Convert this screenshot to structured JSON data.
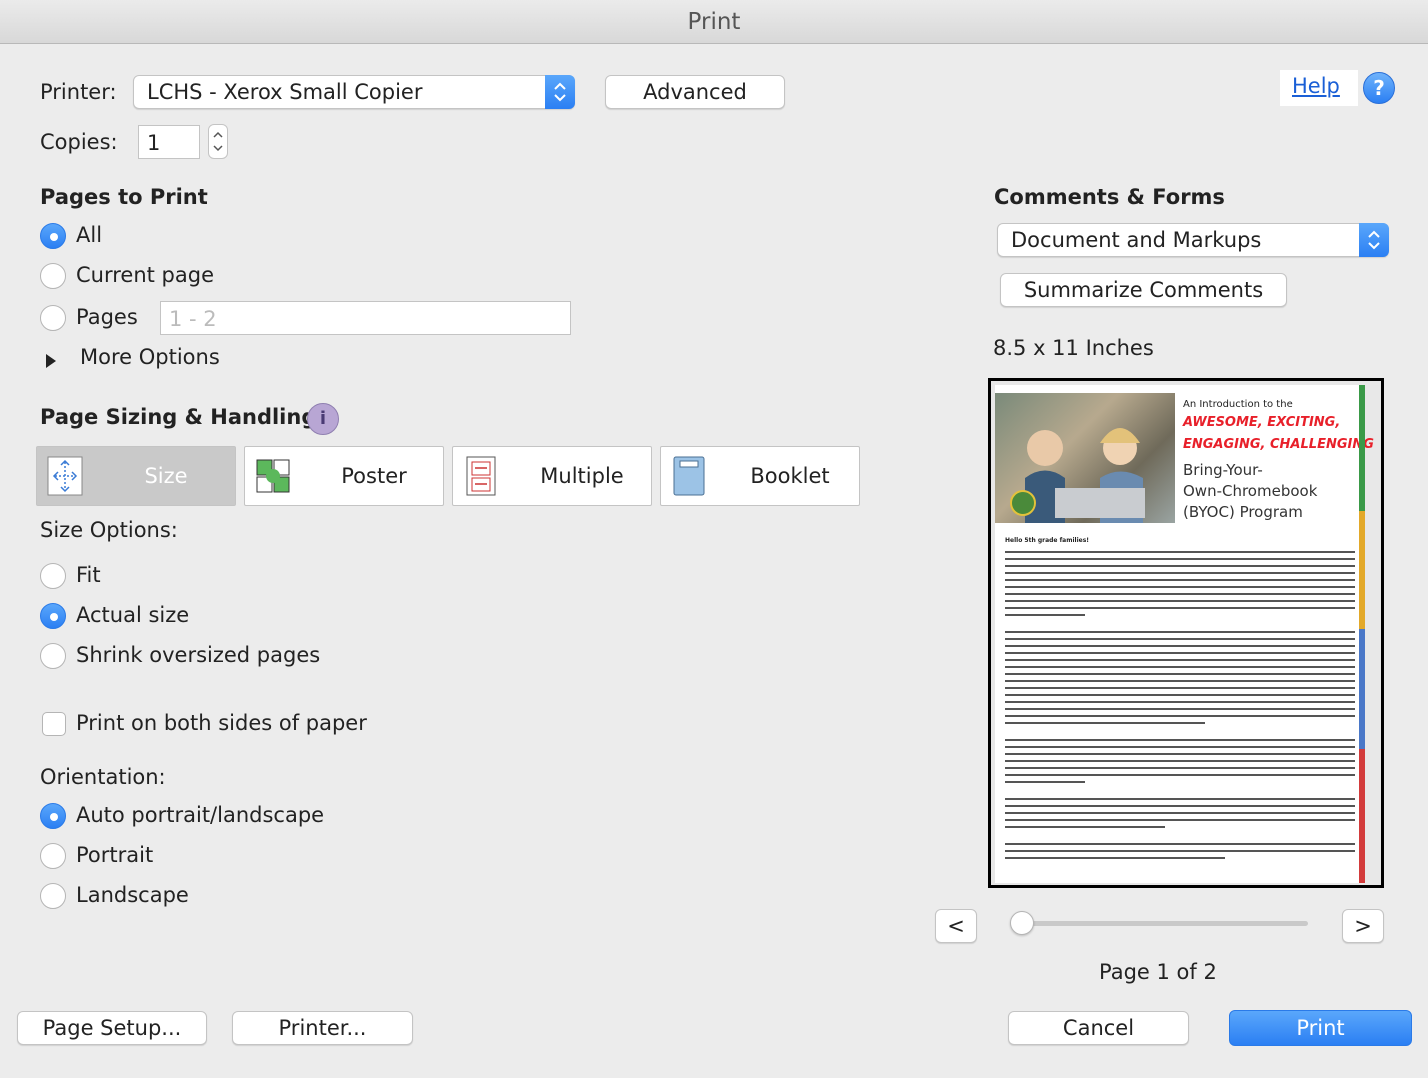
{
  "window": {
    "title": "Print"
  },
  "printer": {
    "label": "Printer:",
    "value": "LCHS - Xerox Small Copier",
    "advanced_label": "Advanced"
  },
  "copies": {
    "label": "Copies:",
    "value": "1"
  },
  "help": {
    "label": "Help"
  },
  "pages_to_print": {
    "heading": "Pages to Print",
    "options": {
      "all": "All",
      "current": "Current page",
      "pages": "Pages"
    },
    "range_placeholder": "1 - 2",
    "more_options": "More Options"
  },
  "sizing": {
    "heading": "Page Sizing & Handling",
    "modes": {
      "size": "Size",
      "poster": "Poster",
      "multiple": "Multiple",
      "booklet": "Booklet"
    },
    "size_options_label": "Size Options:",
    "size_options": {
      "fit": "Fit",
      "actual": "Actual size",
      "shrink": "Shrink oversized pages"
    },
    "duplex": "Print on both sides of paper"
  },
  "orientation": {
    "label": "Orientation:",
    "options": {
      "auto": "Auto portrait/landscape",
      "portrait": "Portrait",
      "landscape": "Landscape"
    }
  },
  "comments_forms": {
    "heading": "Comments & Forms",
    "value": "Document and Markups",
    "summarize_label": "Summarize Comments"
  },
  "preview": {
    "paper_size": "8.5 x 11 Inches",
    "prev": "<",
    "next": ">",
    "page_indicator": "Page 1 of 2",
    "doc": {
      "intro": "An Introduction to the",
      "line1": "AWESOME, EXCITING,",
      "line2": "ENGAGING, CHALLENGING",
      "line3": "Bring-Your-",
      "line4": "Own-Chromebook",
      "line5": "(BYOC) Program",
      "greeting": "Hello 5th grade families!"
    }
  },
  "buttons": {
    "page_setup": "Page Setup...",
    "printer": "Printer...",
    "cancel": "Cancel",
    "print": "Print"
  },
  "colors": {
    "accent": "#2b7ff3",
    "doc_red": "#e8202a",
    "stripe_green": "#3a9a48",
    "stripe_yellow": "#e3a92a",
    "stripe_blue": "#4a78c8",
    "stripe_red": "#d33b3b"
  }
}
